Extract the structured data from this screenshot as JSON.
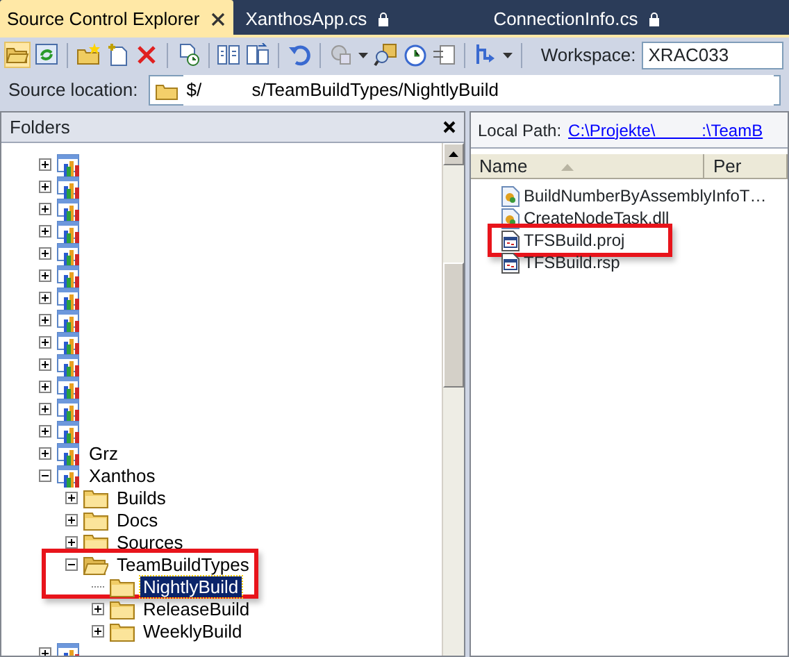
{
  "tabs": [
    {
      "label": "Source Control Explorer",
      "selected": true,
      "locked": false
    },
    {
      "label": "XanthosApp.cs",
      "selected": false,
      "locked": true
    },
    {
      "label": "ConnectionInfo.cs",
      "selected": false,
      "locked": true
    }
  ],
  "toolbar": {
    "workspace_label": "Workspace:",
    "workspace": "XRAC033"
  },
  "source_location": {
    "label": "Source location:",
    "value": "$/          s/TeamBuildTypes/NightlyBuild"
  },
  "folders": {
    "title": "Folders",
    "tree": [
      {
        "kind": "project",
        "expanded": false
      },
      {
        "kind": "project",
        "expanded": false
      },
      {
        "kind": "project",
        "expanded": false
      },
      {
        "kind": "project",
        "expanded": false
      },
      {
        "kind": "project",
        "expanded": false
      },
      {
        "kind": "project",
        "expanded": false
      },
      {
        "kind": "project",
        "expanded": false
      },
      {
        "kind": "project",
        "expanded": false
      },
      {
        "kind": "project",
        "expanded": false
      },
      {
        "kind": "project",
        "expanded": false
      },
      {
        "kind": "project",
        "expanded": false
      },
      {
        "kind": "project",
        "expanded": false
      },
      {
        "kind": "project",
        "expanded": false
      },
      {
        "kind": "project",
        "label": "Grz",
        "expanded": false
      },
      {
        "kind": "project",
        "label": "Xanthos",
        "expanded": true,
        "children": [
          {
            "kind": "folder",
            "label": "Builds",
            "expanded": false
          },
          {
            "kind": "folder",
            "label": "Docs",
            "expanded": false
          },
          {
            "kind": "folder",
            "label": "Sources",
            "expanded": false
          },
          {
            "kind": "folder",
            "label": "TeamBuildTypes",
            "expanded": true,
            "annotated": true,
            "children": [
              {
                "kind": "folder",
                "label": "NightlyBuild",
                "selected": true
              },
              {
                "kind": "folder",
                "label": "ReleaseBuild",
                "expanded": false,
                "selected": false
              },
              {
                "kind": "folder",
                "label": "WeeklyBuild",
                "expanded": false,
                "selected": false
              }
            ]
          }
        ]
      },
      {
        "kind": "project",
        "expanded": false
      }
    ]
  },
  "files": {
    "local_path_label": "Local Path:",
    "local_path": "C:\\Projekte\\          :\\TeamB",
    "columns": [
      "Name",
      "Per"
    ],
    "rows": [
      {
        "name": "BuildNumberByAssemblyInfoT…",
        "kind": "dll",
        "annotated": false
      },
      {
        "name": "CreateNodeTask.dll",
        "kind": "dll",
        "annotated": false
      },
      {
        "name": "TFSBuild.proj",
        "kind": "proj",
        "annotated": true
      },
      {
        "name": "TFSBuild.rsp",
        "kind": "proj",
        "annotated": false
      }
    ]
  }
}
